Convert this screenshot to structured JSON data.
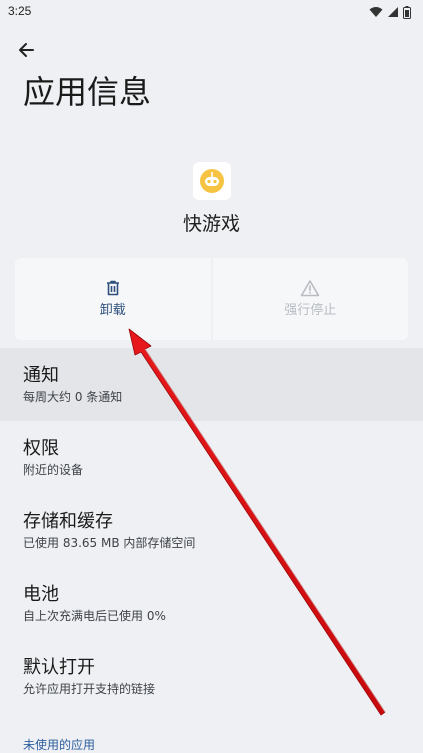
{
  "status_bar": {
    "time": "3:25",
    "icons": [
      "wifi-icon",
      "cellular-signal-icon",
      "battery-icon"
    ]
  },
  "header": {
    "back_icon": "arrow-left-icon",
    "title": "应用信息"
  },
  "app": {
    "icon": "robot-face-icon",
    "icon_color": "#f6c343",
    "name": "快游戏"
  },
  "actions": {
    "uninstall": {
      "label": "卸载",
      "icon": "trash-icon",
      "color": "#2d4f7c"
    },
    "force_stop": {
      "label": "强行停止",
      "icon": "warning-icon",
      "color": "#b8bcc2"
    }
  },
  "settings": [
    {
      "title": "通知",
      "subtitle": "每周大约 0 条通知"
    },
    {
      "title": "权限",
      "subtitle": "附近的设备"
    },
    {
      "title": "存储和缓存",
      "subtitle": "已使用 83.65 MB 内部存储空间"
    },
    {
      "title": "电池",
      "subtitle": "自上次充满电后已使用 0%"
    },
    {
      "title": "默认打开",
      "subtitle": "允许应用打开支持的链接"
    }
  ],
  "footer_link": "未使用的应用",
  "annotation": {
    "arrow_color": "#e8191c"
  }
}
